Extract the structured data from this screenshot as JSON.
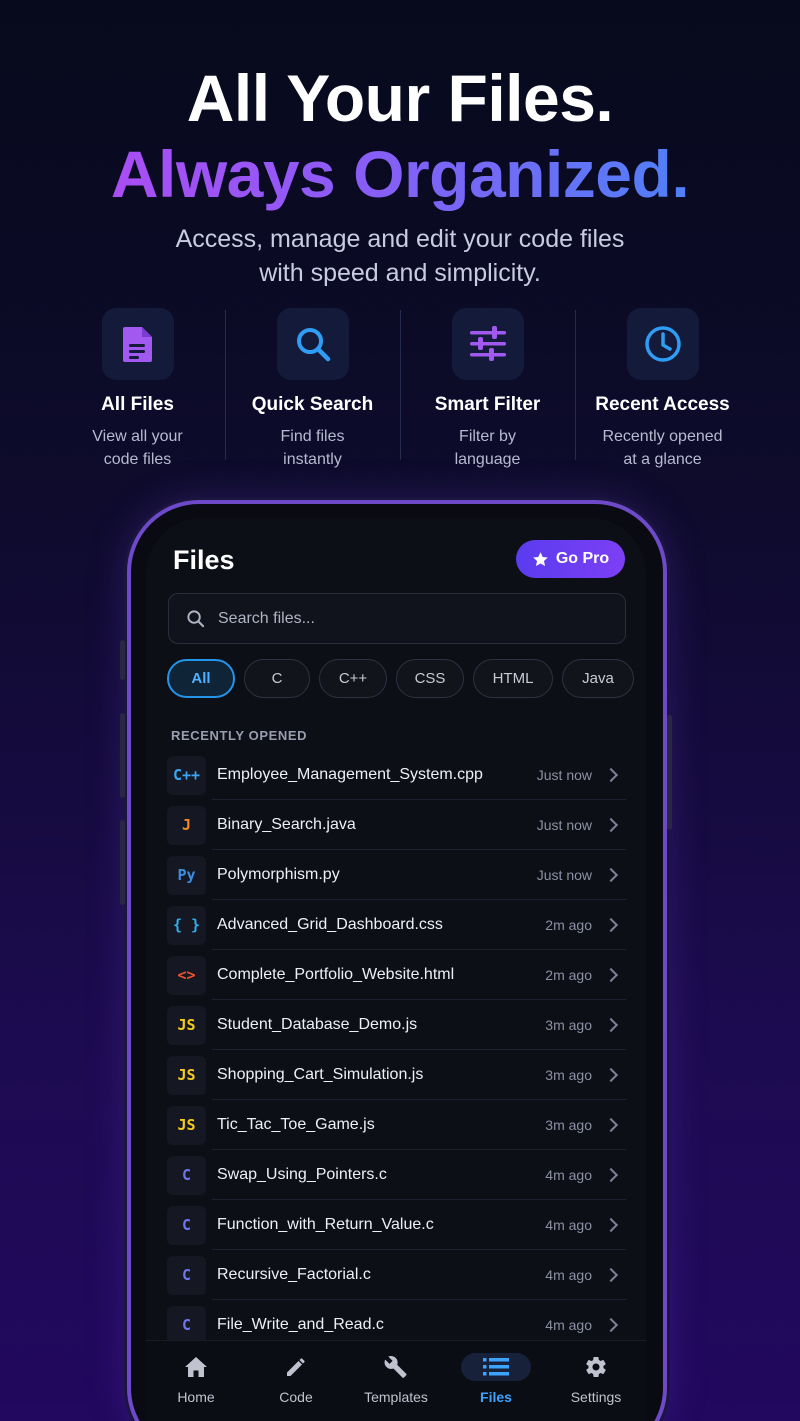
{
  "hero": {
    "line1": "All Your Files.",
    "line2": "Always Organized.",
    "subtitle_line1": "Access, manage and edit your code files",
    "subtitle_line2": "with speed and simplicity."
  },
  "features": [
    {
      "icon": "file-icon",
      "title": "All Files",
      "desc1": "View all your",
      "desc2": "code files",
      "color": "#a259f0"
    },
    {
      "icon": "search-icon",
      "title": "Quick Search",
      "desc1": "Find files",
      "desc2": "instantly",
      "color": "#2f9cf5"
    },
    {
      "icon": "sliders-icon",
      "title": "Smart Filter",
      "desc1": "Filter by",
      "desc2": "language",
      "color": "#a259f0"
    },
    {
      "icon": "clock-icon",
      "title": "Recent Access",
      "desc1": "Recently opened",
      "desc2": "at a glance",
      "color": "#2f9cf5"
    }
  ],
  "app": {
    "title": "Files",
    "go_pro": "Go Pro",
    "search_placeholder": "Search files...",
    "filters": [
      "All",
      "C",
      "C++",
      "CSS",
      "HTML",
      "Java"
    ],
    "active_filter": "All",
    "section_label": "RECENTLY OPENED",
    "files": [
      {
        "badge": "C++",
        "badge_color": "#3aa6f5",
        "name": "Employee_Management_System.cpp",
        "time": "Just now"
      },
      {
        "badge": "J",
        "badge_color": "#f08a24",
        "name": "Binary_Search.java",
        "time": "Just now"
      },
      {
        "badge": "Py",
        "badge_color": "#3b8fe0",
        "name": "Polymorphism.py",
        "time": "Just now"
      },
      {
        "badge": "{ }",
        "badge_color": "#2fb0f0",
        "name": "Advanced_Grid_Dashboard.css",
        "time": "2m ago"
      },
      {
        "badge": "<>",
        "badge_color": "#f0522f",
        "name": "Complete_Portfolio_Website.html",
        "time": "2m ago"
      },
      {
        "badge": "JS",
        "badge_color": "#f5cc1f",
        "name": "Student_Database_Demo.js",
        "time": "3m ago"
      },
      {
        "badge": "JS",
        "badge_color": "#f5cc1f",
        "name": "Shopping_Cart_Simulation.js",
        "time": "3m ago"
      },
      {
        "badge": "JS",
        "badge_color": "#f5cc1f",
        "name": "Tic_Tac_Toe_Game.js",
        "time": "3m ago"
      },
      {
        "badge": "C",
        "badge_color": "#6f74ef",
        "name": "Swap_Using_Pointers.c",
        "time": "4m ago"
      },
      {
        "badge": "C",
        "badge_color": "#6f74ef",
        "name": "Function_with_Return_Value.c",
        "time": "4m ago"
      },
      {
        "badge": "C",
        "badge_color": "#6f74ef",
        "name": "Recursive_Factorial.c",
        "time": "4m ago"
      },
      {
        "badge": "C",
        "badge_color": "#6f74ef",
        "name": "File_Write_and_Read.c",
        "time": "4m ago"
      }
    ],
    "tabs": [
      {
        "icon": "home-icon",
        "label": "Home"
      },
      {
        "icon": "pencil-icon",
        "label": "Code"
      },
      {
        "icon": "wrench-icon",
        "label": "Templates"
      },
      {
        "icon": "list-icon",
        "label": "Files"
      },
      {
        "icon": "gear-icon",
        "label": "Settings"
      }
    ],
    "active_tab": "Files"
  }
}
